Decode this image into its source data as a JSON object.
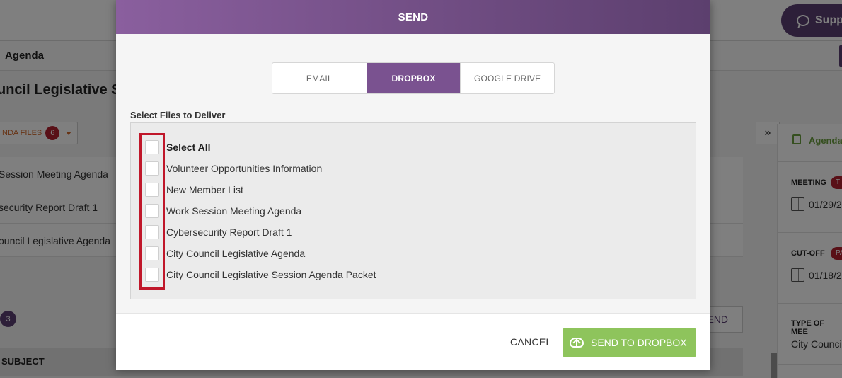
{
  "background": {
    "support_label": "Supp",
    "breadcrumb": "Agenda",
    "page_title": "uncil Legislative Se",
    "files_button": {
      "label": "NDA FILES",
      "count": "6"
    },
    "rows": [
      "Session Meeting Agenda",
      "security Report Draft 1",
      "ouncil Legislative Agenda"
    ],
    "item_count": "3",
    "send_button_partial": "END",
    "subject_header": "SUBJECT",
    "expand_label": "»",
    "side": {
      "agenda_label": "Agenda",
      "meeting_label": "MEETING",
      "meeting_tag": "T",
      "meeting_date": "01/29/2",
      "cutoff_label": "CUT-OFF",
      "cutoff_tag": "PA",
      "cutoff_date": "01/18/2",
      "type_label": "TYPE OF MEE",
      "type_value": "City Counci"
    }
  },
  "modal": {
    "title": "SEND",
    "tabs": [
      {
        "label": "EMAIL",
        "active": false
      },
      {
        "label": "DROPBOX",
        "active": true
      },
      {
        "label": "GOOGLE DRIVE",
        "active": false
      }
    ],
    "files_label": "Select Files to Deliver",
    "select_all": "Select All",
    "files": [
      "Volunteer Opportunities Information",
      "New Member List",
      "Work Session Meeting Agenda",
      "Cybersecurity Report Draft 1",
      "City Council Legislative Agenda",
      "City Council Legislative Session Agenda Packet"
    ],
    "cancel_label": "CANCEL",
    "send_label": "SEND TO DROPBOX"
  }
}
